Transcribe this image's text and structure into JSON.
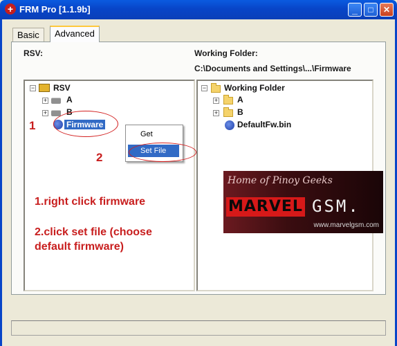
{
  "window": {
    "title": "FRM Pro [1.1.9b]",
    "minimize_glyph": "_",
    "maximize_glyph": "□",
    "close_glyph": "✕"
  },
  "tabs": [
    {
      "label": "Basic",
      "active": false
    },
    {
      "label": "Advanced",
      "active": true
    }
  ],
  "left_panel": {
    "label": "RSV:",
    "tree": {
      "root": "RSV",
      "children": [
        {
          "label": "A",
          "icon": "drive-icon",
          "expand": "+"
        },
        {
          "label": "B",
          "icon": "drive-icon",
          "expand": "+"
        },
        {
          "label": "Firmware",
          "icon": "firmware-icon",
          "selected": true
        }
      ]
    }
  },
  "right_panel": {
    "label": "Working Folder:",
    "path": "C:\\Documents and Settings\\...\\Firmware",
    "tree": {
      "root": "Working Folder",
      "children": [
        {
          "label": "A",
          "icon": "folder-icon",
          "expand": "+"
        },
        {
          "label": "B",
          "icon": "folder-icon",
          "expand": "+"
        },
        {
          "label": "DefaultFw.bin",
          "icon": "firmware-file-icon"
        }
      ]
    }
  },
  "context_menu": {
    "items": [
      {
        "label": "Get",
        "highlighted": false
      },
      {
        "label": "Set File",
        "highlighted": true
      }
    ]
  },
  "annotations": {
    "step1_marker": "1",
    "step2_marker": "2",
    "instruction1": "1.right click firmware",
    "instruction2_line1": "2.click set file (choose",
    "instruction2_line2": "default firmware)",
    "color": "#c81e1e"
  },
  "banner": {
    "tagline": "Home of Pinoy Geeks",
    "brand": "MARVEL",
    "brand_suffix": "GSM.",
    "url": "www.marvelgsm.com"
  },
  "colors": {
    "titlebar": "#0845c8",
    "selection": "#316ac5",
    "window_bg": "#ece9d8"
  }
}
